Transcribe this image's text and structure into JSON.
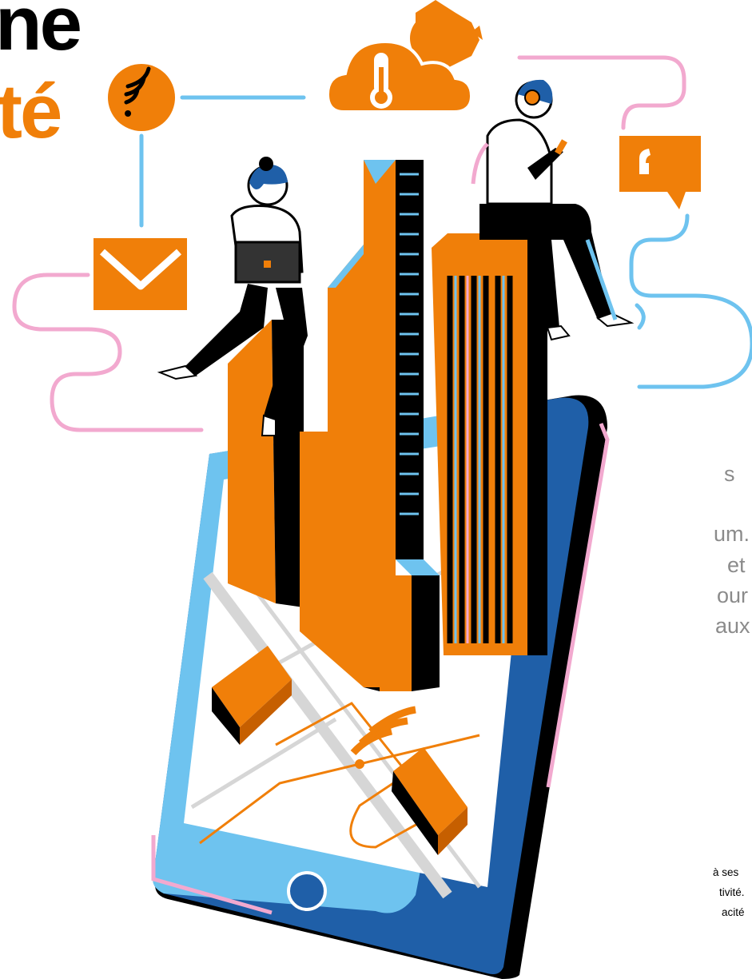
{
  "heading": {
    "line1": "ne",
    "line2": "té"
  },
  "body_text": [
    "s",
    "um.",
    "et",
    "our",
    "aux"
  ],
  "footnote": [
    "à ses",
    "tivité.",
    "acité"
  ],
  "colors": {
    "orange": "#f07f09",
    "light_blue": "#6ec3ef",
    "dark_blue": "#1f5fa8",
    "pink": "#f2a9cf",
    "black": "#000000",
    "grey_text": "#8b8b8b"
  },
  "icons": [
    "wifi-icon",
    "weather-icon",
    "mail-icon",
    "chat-icon",
    "home-button-icon"
  ]
}
